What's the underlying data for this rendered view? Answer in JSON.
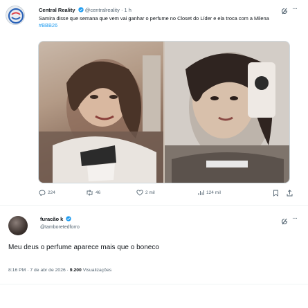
{
  "original_post": {
    "author_name": "Central Reality",
    "author_handle": "@centralreality",
    "time": "· 1 h",
    "text": "Samira disse que semana que vem vai ganhar o perfume no Closet do Líder e ela troca com a Milena ",
    "hashtag": "#BBB26",
    "icons": [
      "grok-icon",
      "more-icon",
      "verified-icon"
    ],
    "actions": {
      "replies": "224",
      "reposts": "46",
      "likes": "2 mil",
      "views": "124 mil"
    }
  },
  "reply_post": {
    "author_name": "furacão k",
    "author_handle": "@tamboretedforro",
    "text": "Meu deus o perfume aparece mais que o boneco",
    "time": "8:16 PM · 7 de abr de 2026 · ",
    "views_count": "9.200",
    "views_label": " Visualizações"
  },
  "colors": {
    "accent": "#1d9bf0",
    "text": "#0f1419",
    "muted": "#536471",
    "divider": "#eff3f4"
  }
}
